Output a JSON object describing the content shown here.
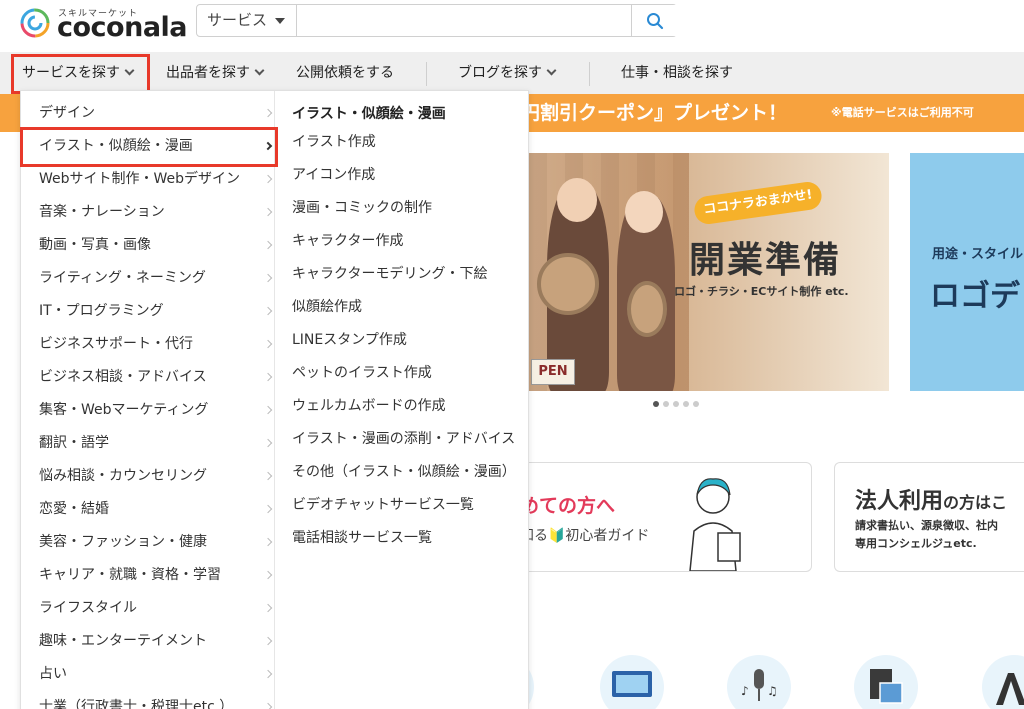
{
  "header": {
    "logo_sub": "スキルマーケット",
    "logo_text": "coconala",
    "search_category": "サービス",
    "search_placeholder": ""
  },
  "nav": [
    {
      "label": "サービスを探す",
      "chevron": true
    },
    {
      "label": "出品者を探す",
      "chevron": true
    },
    {
      "label": "公開依頼をする",
      "chevron": false
    },
    {
      "label": "ブログを探す",
      "chevron": true
    },
    {
      "label": "仕事・相談を探す",
      "chevron": false
    }
  ],
  "promo": {
    "main": "円割引クーポン』プレゼント！",
    "note": "※電話サービスはご利用不可"
  },
  "hero": {
    "tag": "ココナラおまかせ!",
    "title": "開業準備",
    "sub": "ロゴ・チラシ・ECサイト制作 etc.",
    "sign": "PEN"
  },
  "hero2": {
    "line1": "用途・スタイル",
    "line2": "ロゴデ"
  },
  "cards": {
    "beginner_title": "めての方へ",
    "beginner_sub": "知る🔰初心者ガイド",
    "corp_title": "法人利用",
    "corp_title_suffix": "の方はこ",
    "corp_sub1": "請求書払い、源泉徴収、社内",
    "corp_sub2": "専用コンシェルジュetc."
  },
  "menu": {
    "categories": [
      "デザイン",
      "イラスト・似顔絵・漫画",
      "Webサイト制作・Webデザイン",
      "音楽・ナレーション",
      "動画・写真・画像",
      "ライティング・ネーミング",
      "IT・プログラミング",
      "ビジネスサポート・代行",
      "ビジネス相談・アドバイス",
      "集客・Webマーケティング",
      "翻訳・語学",
      "悩み相談・カウンセリング",
      "恋愛・結婚",
      "美容・ファッション・健康",
      "キャリア・就職・資格・学習",
      "ライフスタイル",
      "趣味・エンターテイメント",
      "占い",
      "士業（行政書士・税理士etc.）"
    ],
    "active_index": 1,
    "sub_heading": "イラスト・似顔絵・漫画",
    "sub_items": [
      "イラスト作成",
      "アイコン作成",
      "漫画・コミックの制作",
      "キャラクター作成",
      "キャラクターモデリング・下絵",
      "似顔絵作成",
      "LINEスタンプ作成",
      "ペットのイラスト作成",
      "ウェルカムボードの作成",
      "イラスト・漫画の添削・アドバイス",
      "その他（イラスト・似顔絵・漫画）",
      "ビデオチャットサービス一覧",
      "電話相談サービス一覧"
    ]
  },
  "colors": {
    "highlight": "#e8392a",
    "promo": "#f7a23e",
    "accent_blue": "#2a8ad4"
  }
}
